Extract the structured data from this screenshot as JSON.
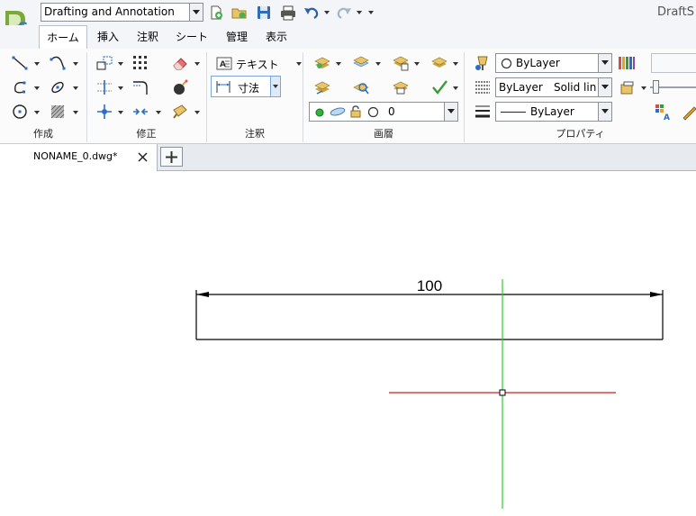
{
  "titlebar": {
    "workspace_value": "Drafting and Annotation",
    "app_title": "DraftS"
  },
  "tabs": [
    {
      "label": "ホーム"
    },
    {
      "label": "挿入"
    },
    {
      "label": "注釈"
    },
    {
      "label": "シート"
    },
    {
      "label": "管理"
    },
    {
      "label": "表示"
    }
  ],
  "ribbon": {
    "panels": {
      "create": "作成",
      "modify": "修正",
      "annotation": "注釈",
      "layers": "画層",
      "properties": "プロパティ"
    },
    "text_button": "テキスト",
    "dimension_button": "寸法",
    "layer_value": "0",
    "color_value": "ByLayer",
    "linetype_value": "ByLayer",
    "linetype_name": "Solid line",
    "lineweight_value": "ByLayer"
  },
  "document_tab": {
    "name": "NONAME_0.dwg*"
  },
  "drawing": {
    "dimension_text": "100",
    "colors": {
      "y_axis": "#33cc33",
      "x_axis": "#cc2222",
      "lines": "#000000"
    }
  }
}
